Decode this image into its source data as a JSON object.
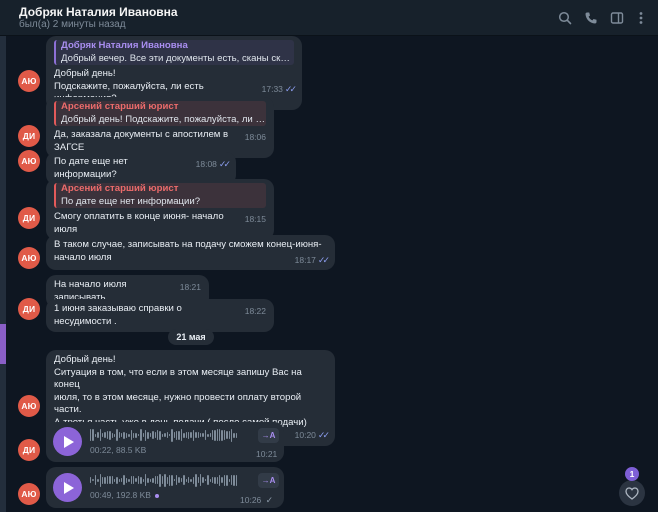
{
  "header": {
    "name": "Добряк Наталия Ивановна",
    "status": "был(а) 2 минуты назад",
    "icons": [
      "search-icon",
      "phone-icon",
      "sidebar-toggle-icon",
      "more-vertical-icon"
    ]
  },
  "messages": [
    {
      "avatar": "АЮ",
      "reply_name": "Добряк Наталия Ивановна",
      "reply_text": "Добрый вечер. Все эти документы есть, сканы скинул...",
      "lines": [
        "Добрый день!",
        "Подскажите, пожалуйста, ли есть информация?"
      ],
      "time": "17:33"
    },
    {
      "avatar": "ДИ",
      "reply_name": "Арсений старший юрист",
      "reply_text": "Добрый день! Подскажите, пожалуйста, ли ест...",
      "lines": [
        "Да, заказала документы с апостилем в ЗАГСЕ"
      ],
      "time": "18:06"
    },
    {
      "avatar": "АЮ",
      "lines": [
        "По дате еще нет информации?"
      ],
      "time": "18:08"
    },
    {
      "avatar": "ДИ",
      "reply_name": "Арсений старший юрист",
      "reply_text": "По дате еще нет информации?",
      "lines": [
        "Смогу оплатить в конце июня- начало июля"
      ],
      "time": "18:15"
    },
    {
      "avatar": "АЮ",
      "lines": [
        "В таком случае, записывать на подачу сможем конец-июня-",
        "начало июля"
      ],
      "time": "18:17"
    },
    {
      "lines": [
        "На начало июля записывать"
      ],
      "time": "18:21"
    },
    {
      "avatar": "ДИ",
      "lines": [
        "1 июня заказываю справки о  несудимости ."
      ],
      "time": "18:22"
    },
    {
      "avatar": "АЮ",
      "lines": [
        "Добрый день!",
        "Ситуация в том, что если в этом месяце запишу Вас на конец",
        "июля, то в этом месяце, нужно провести оплату второй части.",
        "А третья часть уже в день подачи ( после самой подачи)"
      ],
      "time": "10:20"
    }
  ],
  "date_divider": "21 мая",
  "voices": [
    {
      "avatar": "ДИ",
      "info": "00:22, 88.5 KB",
      "time": "10:21",
      "transcribe": "→A"
    },
    {
      "avatar": "АЮ",
      "info": "00:49, 192.8 KB",
      "time": "10:26",
      "transcribe": "→A"
    }
  ],
  "fab": {
    "badge": "1",
    "icon": "heart-icon"
  },
  "colors": {
    "accent": "#8c64d8",
    "avatar": "#e05a48",
    "bubble": "#252d37",
    "background": "#0e1621"
  }
}
